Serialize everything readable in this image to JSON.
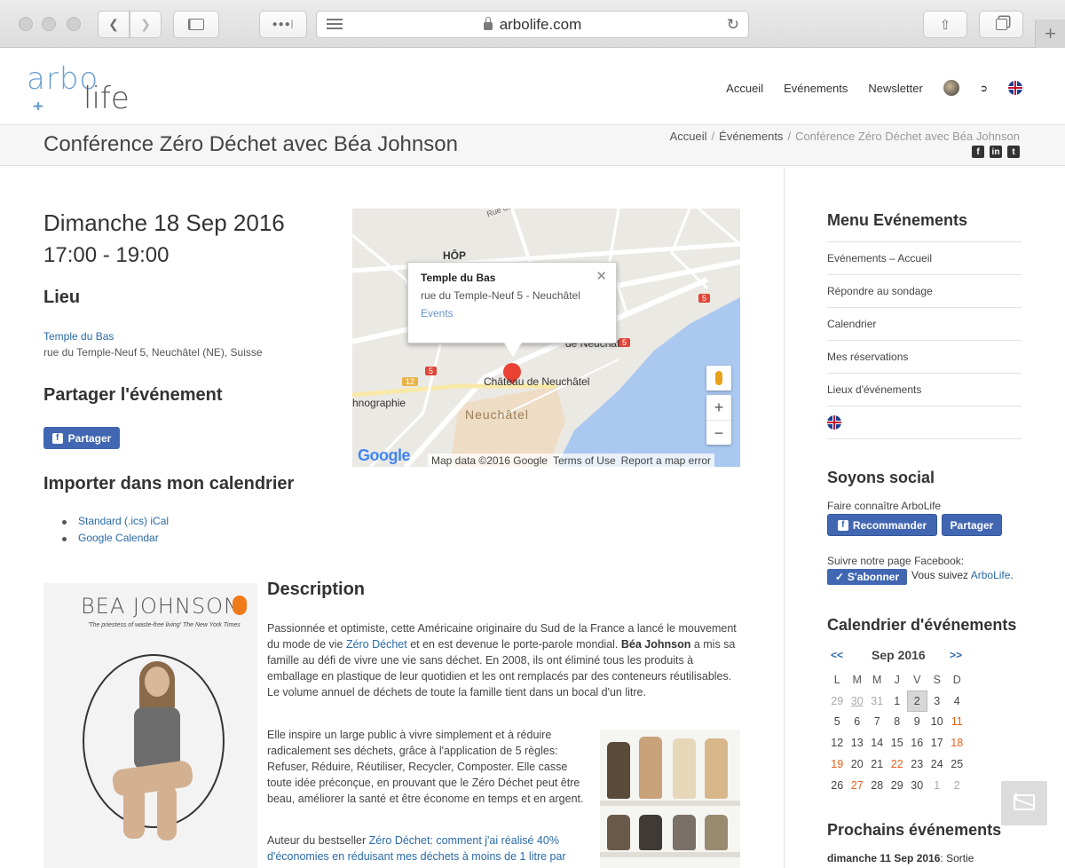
{
  "browser": {
    "url": "arbolife.com"
  },
  "logo": {
    "part1": "arbo",
    "part2": "life"
  },
  "nav": {
    "items": [
      "Accueil",
      "Evénements",
      "Newsletter"
    ]
  },
  "page": {
    "title": "Conférence Zéro Déchet avec Béa Johnson",
    "breadcrumb": [
      "Accueil",
      "Événements",
      "Conférence Zéro Déchet avec Béa Johnson"
    ]
  },
  "event": {
    "date": "Dimanche 18 Sep 2016",
    "time": "17:00 - 19:00",
    "venue_heading": "Lieu",
    "venue_name": "Temple du Bas",
    "venue_address": "rue du Temple-Neuf 5, Neuchâtel (NE), Suisse",
    "share_heading": "Partager l'événement",
    "share_button": "Partager",
    "import_heading": "Importer dans mon calendrier",
    "calendar_links": [
      "Standard (.ics) iCal",
      "Google Calendar"
    ]
  },
  "map": {
    "info_title": "Temple du Bas",
    "info_address": "rue du Temple-Neuf 5 - Neuchâtel",
    "info_link": "Events",
    "labels": [
      "HÔP",
      "Château de Neuchâtel",
      "hnographie",
      "Neuchâtel",
      "de Neuchâtel",
      "Rue des Parcs"
    ],
    "route_signs": [
      "5",
      "12",
      "5",
      "5"
    ],
    "google": "Google",
    "footer": [
      "Map data ©2016 Google",
      "Terms of Use",
      "Report a map error"
    ]
  },
  "book": {
    "title": "BEA JOHNSON",
    "subtitle": "'The priestess of waste-free living' The New York Times"
  },
  "description": {
    "heading": "Description",
    "p1_a": "Passionnée et optimiste, cette Américaine originaire du Sud de la France a lancé le mouvement du mode de vie ",
    "p1_link": "Zéro Déchet",
    "p1_b": " et en est devenue le porte-parole mondial. ",
    "p1_bold": "Béa Johnson",
    "p1_c": " a mis sa famille au défi de vivre une vie sans déchet. En 2008, ils ont éliminé tous les produits à emballage en plastique de leur quotidien et les ont remplacés par des conteneurs réutilisables. Le volume annuel de déchets de toute la famille tient dans un bocal d'un litre.",
    "p2": "Elle inspire un large public à vivre simplement et à réduire radicalement ses déchets, grâce à l'application de 5 règles: Refuser, Réduire, Réutiliser, Recycler, Composter. Elle casse toute idée préconçue, en prouvant que le Zéro Déchet peut être beau, améliorer la santé et être économe en temps et en argent.",
    "p3_a": "Auteur du bestseller ",
    "p3_link": "Zéro Déchet: comment j'ai réalisé  40% d'économies en réduisant mes déchets à moins de 1 litre par"
  },
  "sidebar": {
    "menu_heading": "Menu Evénements",
    "menu_items": [
      "Evénements – Accueil",
      "Répondre au sondage",
      "Calendrier",
      "Mes réservations",
      "Lieux d'événements"
    ],
    "social_heading": "Soyons social",
    "social_text": "Faire connaître ArboLife",
    "recommend_button": "Recommander",
    "share_button": "Partager",
    "follow_text": "Suivre notre page Facebook:",
    "subscribe_button": "S'abonner",
    "following_a": "Vous suivez ",
    "following_link": "ArboLife",
    "following_b": ".",
    "calendar_heading": "Calendrier d'événements",
    "calendar_month": "Sep 2016",
    "calendar_prev": "<<",
    "calendar_next": ">>",
    "day_names": [
      "L",
      "M",
      "M",
      "J",
      "V",
      "S",
      "D"
    ],
    "calendar_cells": [
      {
        "d": "29",
        "c": "om"
      },
      {
        "d": "30",
        "c": "om u"
      },
      {
        "d": "31",
        "c": "om"
      },
      {
        "d": "1",
        "c": ""
      },
      {
        "d": "2",
        "c": "today"
      },
      {
        "d": "3",
        "c": ""
      },
      {
        "d": "4",
        "c": ""
      },
      {
        "d": "5",
        "c": ""
      },
      {
        "d": "6",
        "c": ""
      },
      {
        "d": "7",
        "c": ""
      },
      {
        "d": "8",
        "c": ""
      },
      {
        "d": "9",
        "c": ""
      },
      {
        "d": "10",
        "c": ""
      },
      {
        "d": "11",
        "c": "ev"
      },
      {
        "d": "12",
        "c": ""
      },
      {
        "d": "13",
        "c": ""
      },
      {
        "d": "14",
        "c": ""
      },
      {
        "d": "15",
        "c": ""
      },
      {
        "d": "16",
        "c": ""
      },
      {
        "d": "17",
        "c": ""
      },
      {
        "d": "18",
        "c": "ev"
      },
      {
        "d": "19",
        "c": "ev"
      },
      {
        "d": "20",
        "c": ""
      },
      {
        "d": "21",
        "c": ""
      },
      {
        "d": "22",
        "c": "ev"
      },
      {
        "d": "23",
        "c": ""
      },
      {
        "d": "24",
        "c": ""
      },
      {
        "d": "25",
        "c": ""
      },
      {
        "d": "26",
        "c": ""
      },
      {
        "d": "27",
        "c": "ev"
      },
      {
        "d": "28",
        "c": ""
      },
      {
        "d": "29",
        "c": ""
      },
      {
        "d": "30",
        "c": ""
      },
      {
        "d": "1",
        "c": "om"
      },
      {
        "d": "2",
        "c": "om"
      }
    ],
    "upcoming_heading": "Prochains événements",
    "upcoming_date": "dimanche 11 Sep 2016",
    "upcoming_rest": ": Sortie"
  },
  "colors": {
    "link": "#2a6aa6",
    "facebook": "#4267b2",
    "event_day": "#e8601c"
  }
}
